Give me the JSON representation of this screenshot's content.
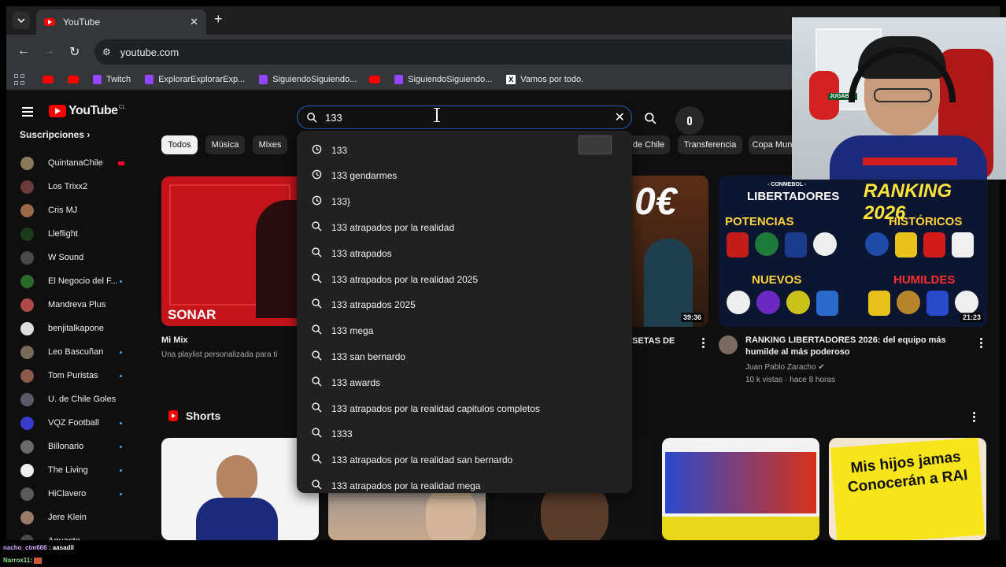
{
  "browser": {
    "tab_title": "YouTube",
    "url": "youtube.com",
    "bookmarks": [
      {
        "label": "",
        "icon": "youtube-icon"
      },
      {
        "label": "",
        "icon": "youtube-icon"
      },
      {
        "label": "Twitch",
        "icon": "twitch-icon"
      },
      {
        "label": "ExplorarExplorarExp...",
        "icon": "twitch-icon"
      },
      {
        "label": "SiguiendoSiguiendo...",
        "icon": "twitch-icon"
      },
      {
        "label": "",
        "icon": "youtube-icon"
      },
      {
        "label": "SiguiendoSiguiendo...",
        "icon": "twitch-icon"
      },
      {
        "label": "Vamos por todo.",
        "icon": "x-icon"
      }
    ]
  },
  "youtube": {
    "logo_text": "YouTube",
    "country": "CL",
    "search_value": "133",
    "subscriptions_title": "Suscripciones",
    "subscriptions": [
      {
        "name": "QuintanaChile",
        "marker": "live",
        "color": "#8a7a5a"
      },
      {
        "name": "Los Trixx2",
        "marker": "",
        "color": "#6b3b3b"
      },
      {
        "name": "Cris MJ",
        "marker": "",
        "color": "#9a6a4a"
      },
      {
        "name": "Lleflight",
        "marker": "",
        "color": "#1a3a1a"
      },
      {
        "name": "W Sound",
        "marker": "",
        "color": "#4a4a4a"
      },
      {
        "name": "El Negocio del F...",
        "marker": "dot",
        "color": "#2a6a2a"
      },
      {
        "name": "Mandreva Plus",
        "marker": "",
        "color": "#b04a4a"
      },
      {
        "name": "benjitalkapone",
        "marker": "",
        "color": "#dddddd"
      },
      {
        "name": "Leo Bascuñan",
        "marker": "dot",
        "color": "#7a6a5a"
      },
      {
        "name": "Tom Puristas",
        "marker": "dot",
        "color": "#8a5a4a"
      },
      {
        "name": "U. de Chile Goles",
        "marker": "",
        "color": "#5a5a6a"
      },
      {
        "name": "VQZ Football",
        "marker": "dot",
        "color": "#3a3acc"
      },
      {
        "name": "Billonario",
        "marker": "dot",
        "color": "#6a6a6a"
      },
      {
        "name": "The Living",
        "marker": "dot",
        "color": "#eeeeee"
      },
      {
        "name": "HiClavero",
        "marker": "dot",
        "color": "#5a5a5a"
      },
      {
        "name": "Jere Klein",
        "marker": "",
        "color": "#9a7a6a"
      },
      {
        "name": "Aguanta",
        "marker": "",
        "color": "#4a4a4a"
      }
    ],
    "chips": [
      "Todos",
      "Música",
      "Mixes",
      "de Chile",
      "Transferencia",
      "Copa Mund"
    ],
    "videos": [
      {
        "title": "Mi Mix",
        "meta1": "Una playlist personalizada para ti",
        "meta2": "",
        "duration": "",
        "thumb_text": "SONAR"
      },
      {
        "title": "ISETAS DE",
        "meta1": "",
        "meta2": "",
        "duration": "39:36",
        "thumb_text": "0€"
      },
      {
        "title": "RANKING LIBERTADORES 2026: del equipo más humilde al más poderoso",
        "meta1": "Juan Pablo Zaracho",
        "meta2": "10 k vistas · hace 8 horas",
        "duration": "21:23",
        "thumb_text": ""
      }
    ],
    "ranking_thumb": {
      "conmebol": "- CONMEBOL -",
      "libertadores": "LIBERTADORES",
      "ranking": "RANKING 2026",
      "potencias": "POTENCIAS",
      "historicos": "HISTÓRICOS",
      "nuevos": "NUEVOS",
      "humildes": "HUMILDES"
    },
    "shorts_title": "Shorts",
    "short_caption": "Mis hijos jamas Conocerán a RAI",
    "suggestions": [
      {
        "text": "133",
        "icon": "history-icon"
      },
      {
        "text": "133 gendarmes",
        "icon": "history-icon"
      },
      {
        "text": "133}",
        "icon": "history-icon"
      },
      {
        "text": "133 atrapados por la realidad",
        "icon": "search-icon"
      },
      {
        "text": "133 atrapados",
        "icon": "search-icon"
      },
      {
        "text": "133 atrapados por la realidad 2025",
        "icon": "search-icon"
      },
      {
        "text": "133 atrapados 2025",
        "icon": "search-icon"
      },
      {
        "text": "133 mega",
        "icon": "search-icon"
      },
      {
        "text": "133 san bernardo",
        "icon": "search-icon"
      },
      {
        "text": "133 awards",
        "icon": "search-icon"
      },
      {
        "text": "133 atrapados por la realidad capitulos completos",
        "icon": "search-icon"
      },
      {
        "text": "1333",
        "icon": "search-icon"
      },
      {
        "text": "133 atrapados por la realidad san bernardo",
        "icon": "search-icon"
      },
      {
        "text": "133 atrapados por la realidad mega",
        "icon": "search-icon"
      }
    ]
  },
  "stream_overlay": {
    "cam_sponsor": "JUGABET",
    "chat": [
      {
        "user": "nacho_ctm666",
        "message": ": aasadil"
      },
      {
        "user": "Narrox11",
        "message": ":"
      }
    ]
  }
}
